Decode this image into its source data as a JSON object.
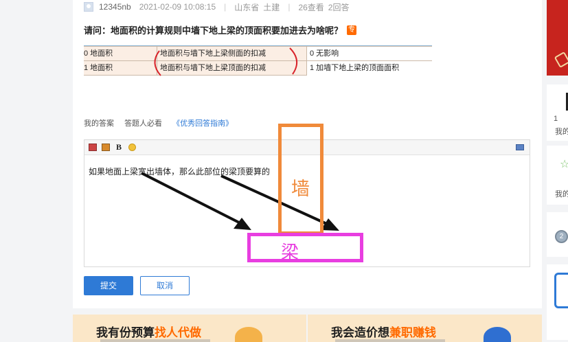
{
  "question": {
    "user": "12345nb",
    "datetime": "2021-02-09 10:08:15",
    "location": "山东省",
    "category": "土建",
    "views": "26查看",
    "answers": "2回答",
    "title": "请问：地面积的计算规则中墙下地上梁的顶面积要加进去为啥呢？",
    "tag": "专"
  },
  "question_image": {
    "rows": [
      {
        "c1": "0 地面积",
        "c2": "地面积与墙下地上梁侧面的扣减",
        "c3": "0  无影响"
      },
      {
        "c1": "1 地面积",
        "c2": "地面积与墙下地上梁顶面的扣减",
        "c3": "1  加墙下地上梁的顶面面积"
      }
    ]
  },
  "answer_tabs": {
    "my_answer": "我的答案",
    "must_read": "答题人必看",
    "guide_link": "《优秀回答指南》"
  },
  "editor": {
    "bold_label": "B",
    "content": "如果地面上梁宽出墙体，那么此部位的梁顶要算的"
  },
  "buttons": {
    "submit": "提交",
    "cancel": "取消"
  },
  "annotations": {
    "wall_label": "墙",
    "beam_label": "梁",
    "wall_color": "#f08a3a",
    "beam_color": "#e83ee0"
  },
  "banners": {
    "left_text": "我有份预算",
    "left_highlight": "找人代做",
    "right_text": "我会造价想",
    "right_highlight": "兼职赚钱",
    "highlight_color": "#ff6a00"
  },
  "sidebar": {
    "s2_line1": "1",
    "s2_line2": "我的",
    "s3_line1": "我的",
    "s4_medal": "2"
  },
  "icons": [
    "user-avatar-icon",
    "image-icon",
    "picture-icon",
    "bold-icon",
    "emoji-icon",
    "fullscreen-icon",
    "star-icon",
    "medal-icon",
    "calendar-icon"
  ],
  "colors": {
    "accent": "#2e7ad6",
    "banner_bg": "#fbe7c8"
  }
}
